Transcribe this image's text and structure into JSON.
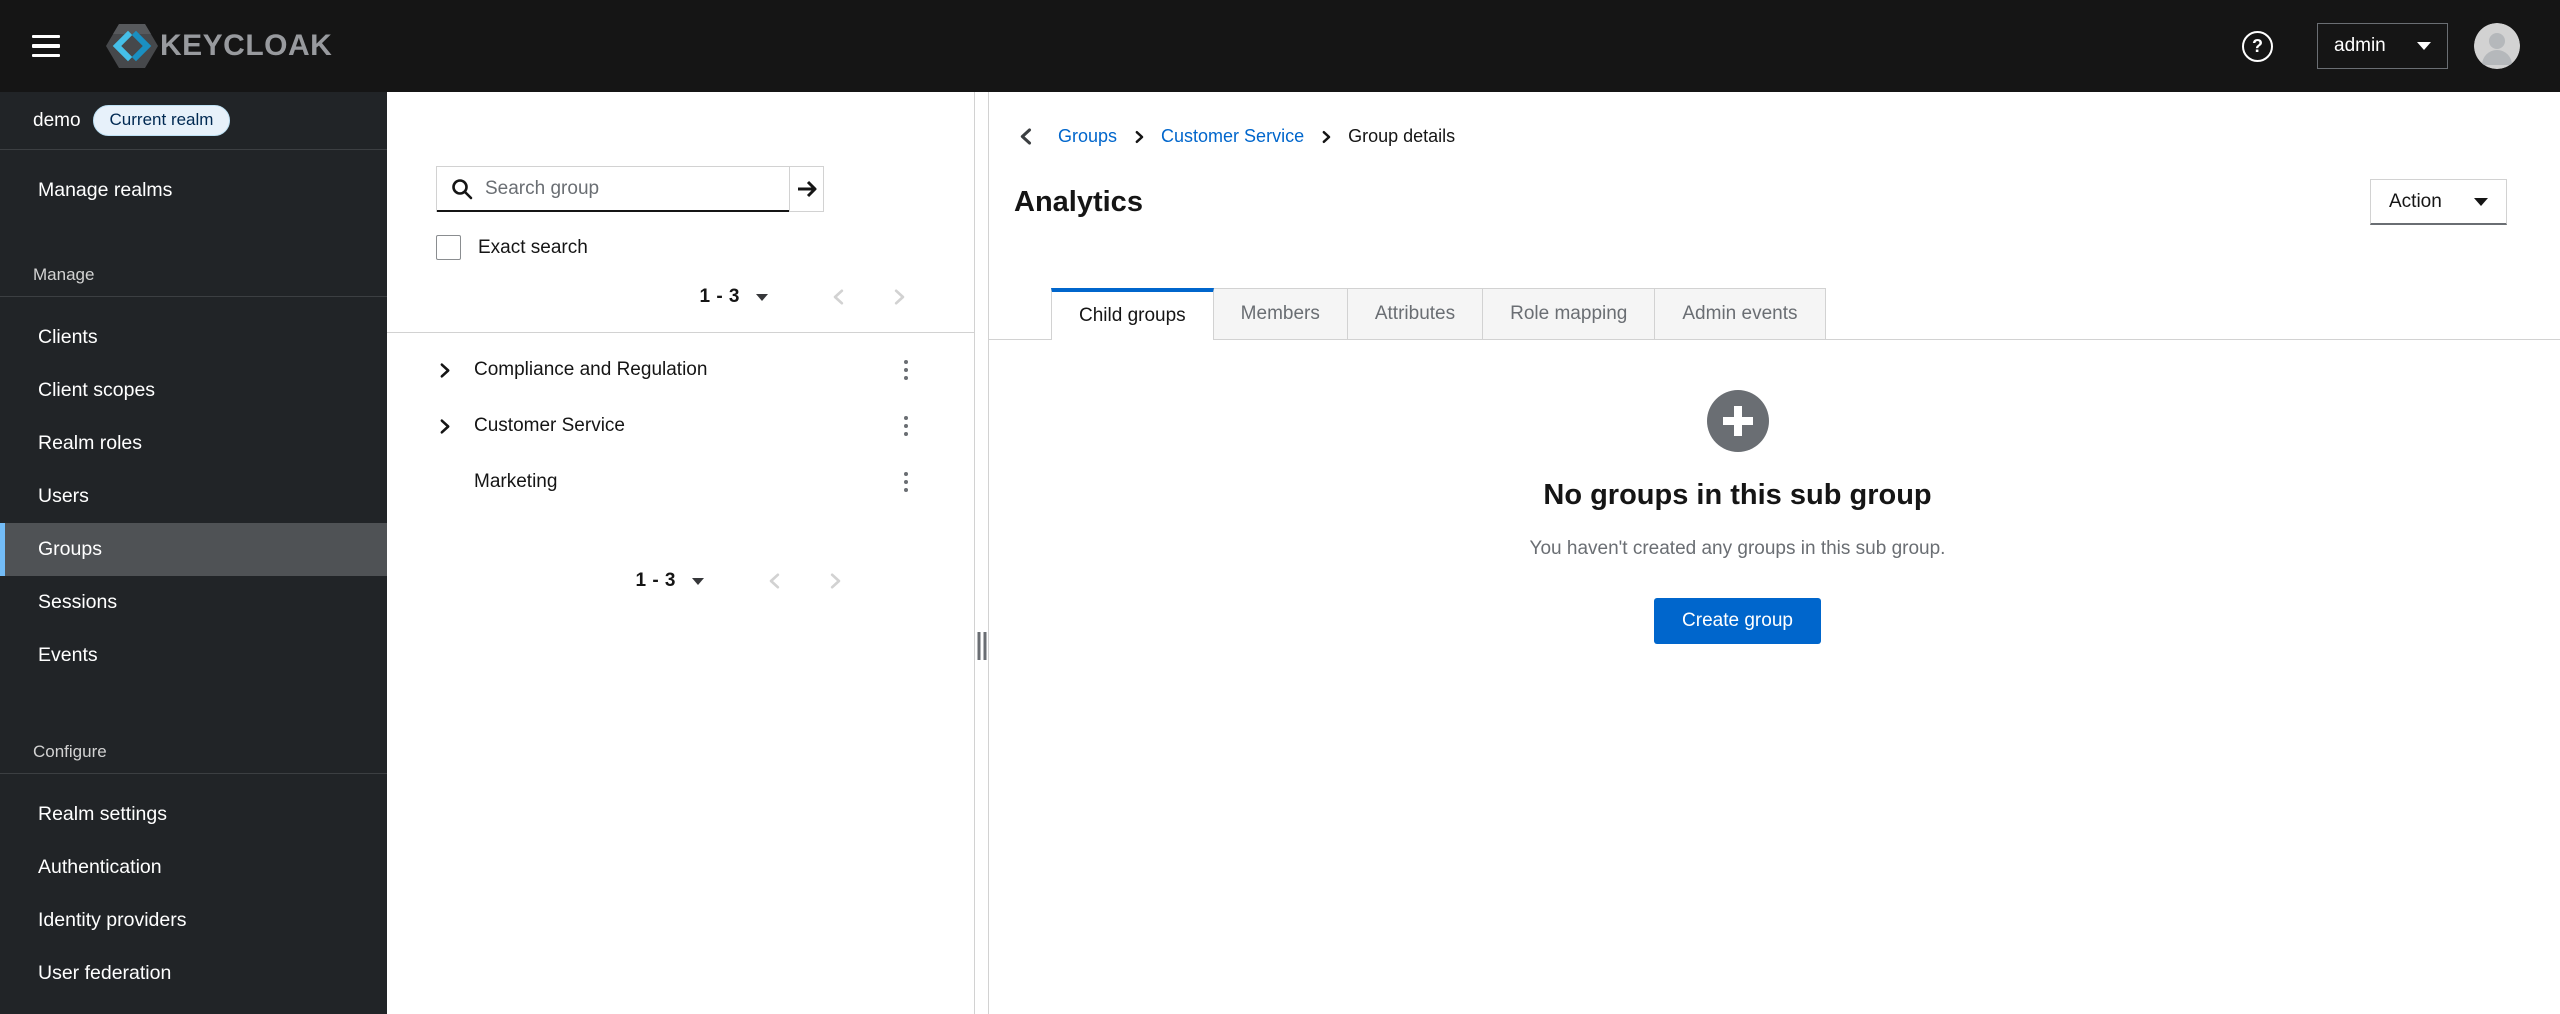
{
  "masthead": {
    "brand": "KEYCLOAK",
    "help_glyph": "?",
    "user": "admin"
  },
  "sidebar": {
    "realm": "demo",
    "realm_badge": "Current realm",
    "manage_realms": "Manage realms",
    "sections": [
      {
        "title": "Manage",
        "items": [
          "Clients",
          "Client scopes",
          "Realm roles",
          "Users",
          "Groups",
          "Sessions",
          "Events"
        ],
        "current_item": "Groups"
      },
      {
        "title": "Configure",
        "items": [
          "Realm settings",
          "Authentication",
          "Identity providers",
          "User federation"
        ]
      }
    ]
  },
  "tree": {
    "search": {
      "placeholder": "Search group"
    },
    "exact_search_label": "Exact search",
    "pagination": {
      "range": "1 - 3"
    },
    "groups": [
      {
        "name": "Compliance and Regulation",
        "expandable": true
      },
      {
        "name": "Customer Service",
        "expandable": true
      },
      {
        "name": "Marketing",
        "expandable": false
      }
    ]
  },
  "main": {
    "breadcrumb": [
      "Groups",
      "Customer Service",
      "Group details"
    ],
    "title": "Analytics",
    "action_label": "Action",
    "tabs": [
      "Child groups",
      "Members",
      "Attributes",
      "Role mapping",
      "Admin events"
    ],
    "active_tab": "Child groups",
    "empty_state": {
      "title": "No groups in this sub group",
      "description": "You haven't created any groups in this sub group.",
      "button": "Create group"
    }
  },
  "colors": {
    "accent": "#0066cc",
    "masthead_bg": "#151515",
    "sidebar_bg": "#212427",
    "nav_current_bg": "#4f5255",
    "nav_current_border": "#73bcf7",
    "badge_bg": "#e7f1fa",
    "badge_text": "#002952",
    "muted_text": "#6a6e73",
    "border": "#d2d2d2"
  }
}
